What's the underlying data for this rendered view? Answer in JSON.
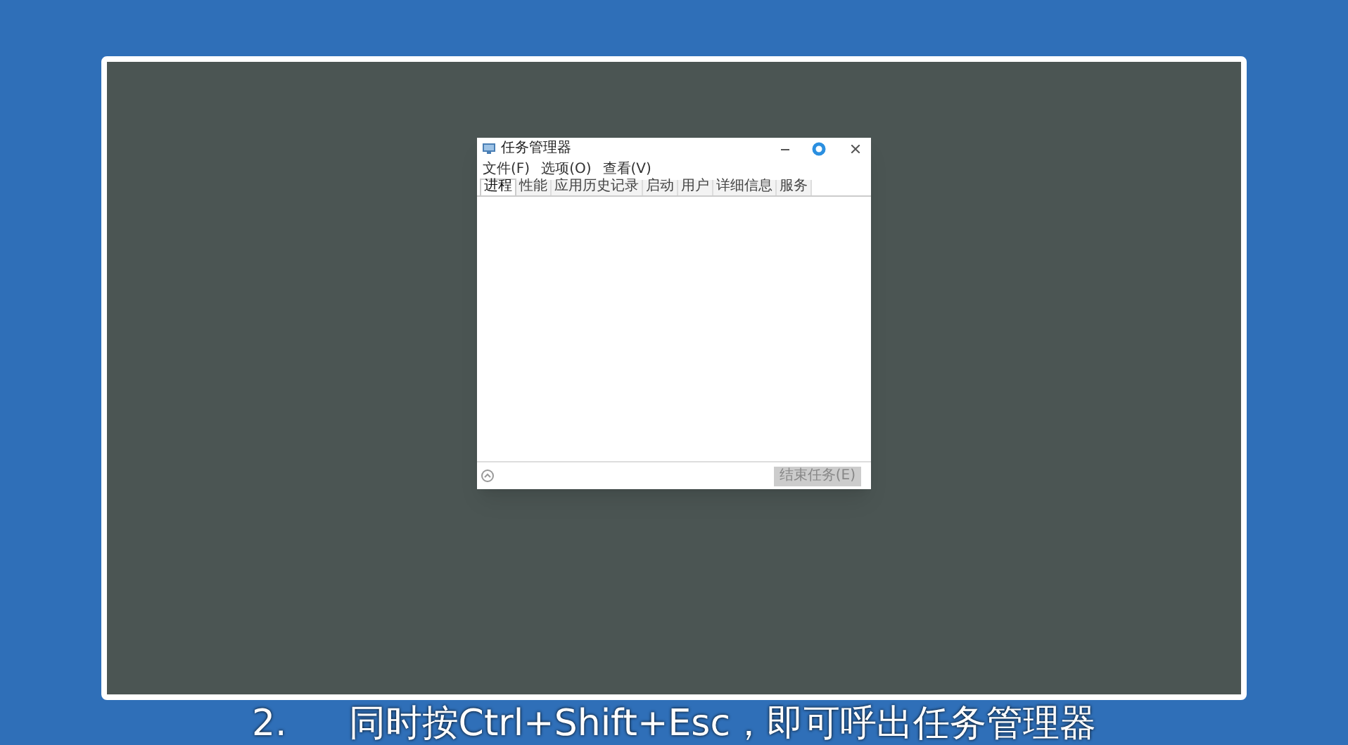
{
  "window": {
    "title": "任务管理器"
  },
  "menu": [
    "文件(F)",
    "选项(O)",
    "查看(V)"
  ],
  "tabs": [
    {
      "label": "进程",
      "selected": true
    },
    {
      "label": "性能",
      "selected": false
    },
    {
      "label": "应用历史记录",
      "selected": false
    },
    {
      "label": "启动",
      "selected": false
    },
    {
      "label": "用户",
      "selected": false
    },
    {
      "label": "详细信息",
      "selected": false
    },
    {
      "label": "服务",
      "selected": false
    }
  ],
  "end_task_button": {
    "label": "结束任务(E)",
    "disabled": true
  },
  "subtitle": {
    "step": "2.",
    "text": "同时按Ctrl+Shift+Esc，即可呼出任务管理器"
  }
}
